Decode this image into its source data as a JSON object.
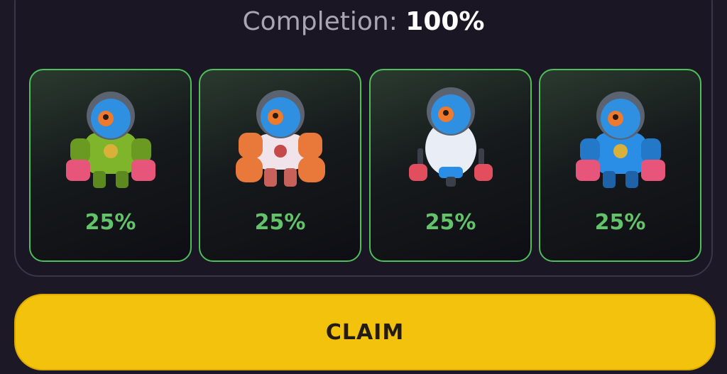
{
  "header": {
    "completion_label": "Completion:",
    "completion_value": "100%"
  },
  "cards": [
    {
      "percent": "25%",
      "variant": "green-robot",
      "color": "#7fb52a"
    },
    {
      "percent": "25%",
      "variant": "orange-robot",
      "color": "#e8793a"
    },
    {
      "percent": "25%",
      "variant": "white-robot",
      "color": "#e9eef6"
    },
    {
      "percent": "25%",
      "variant": "blue-robot",
      "color": "#2a8ee6"
    }
  ],
  "claim_button": {
    "label": "CLAIM"
  },
  "colors": {
    "accent": "#f2c20c",
    "card_border": "#4fbf5b",
    "percent_text": "#62c36b",
    "background": "#1c1826"
  }
}
